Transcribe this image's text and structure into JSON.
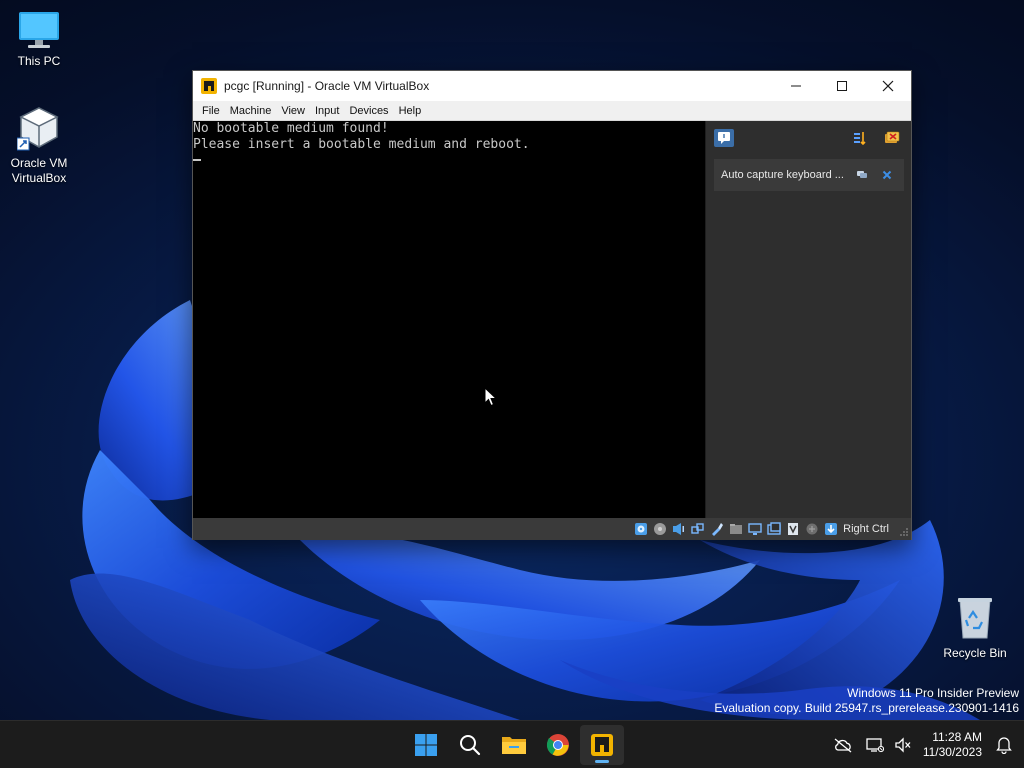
{
  "desktop": {
    "icons": [
      {
        "label": "This PC"
      },
      {
        "label": "Oracle VM\nVirtualBox"
      },
      {
        "label": "Recycle Bin"
      }
    ],
    "watermark": {
      "line1": "Windows 11 Pro Insider Preview",
      "line2": "Evaluation copy. Build 25947.rs_prerelease.230901-1416"
    }
  },
  "window": {
    "title": "pcgc [Running] - Oracle VM VirtualBox",
    "menu": [
      "File",
      "Machine",
      "View",
      "Input",
      "Devices",
      "Help"
    ],
    "console_lines": [
      "No bootable medium found!",
      "Please insert a bootable medium and reboot."
    ],
    "notification": {
      "text": "Auto capture keyboard ..."
    },
    "statusbar": {
      "host_key": "Right Ctrl"
    }
  },
  "taskbar": {
    "apps": [
      "start",
      "search",
      "file-explorer",
      "chrome",
      "virtualbox"
    ],
    "active_app": "virtualbox",
    "clock": {
      "time": "11:28 AM",
      "date": "11/30/2023"
    }
  },
  "colors": {
    "accent": "#5fb2f2",
    "vm_background": "#000000",
    "console_text": "#c8c8c8"
  }
}
